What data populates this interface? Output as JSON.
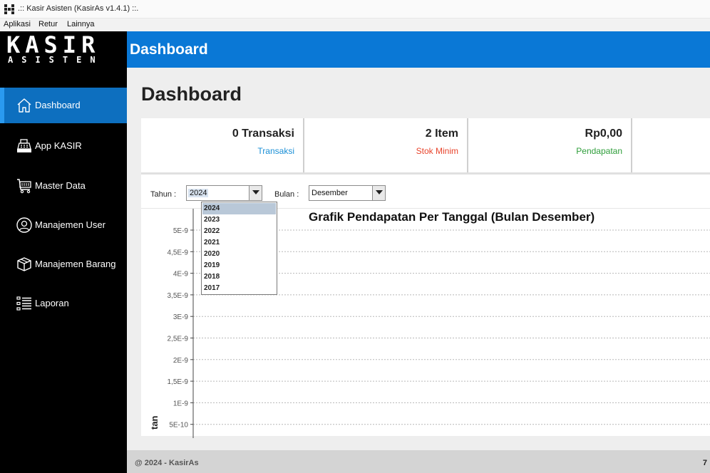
{
  "window": {
    "title": ".:: Kasir Asisten (KasirAs v1.4.1) ::."
  },
  "menu": [
    "Aplikasi",
    "Retur",
    "Lainnya"
  ],
  "logo": {
    "main": "KASIR",
    "sub": "ASISTEN"
  },
  "header": {
    "title": "Dashboard"
  },
  "sidebar": {
    "items": [
      {
        "label": "Dashboard",
        "icon": "home-icon",
        "active": true
      },
      {
        "label": "App KASIR",
        "icon": "cash-register-icon",
        "active": false
      },
      {
        "label": "Master Data",
        "icon": "cart-icon",
        "active": false
      },
      {
        "label": "Manajemen User",
        "icon": "user-icon",
        "active": false
      },
      {
        "label": "Manajemen Barang",
        "icon": "box-icon",
        "active": false
      },
      {
        "label": "Laporan",
        "icon": "list-icon",
        "active": false
      }
    ]
  },
  "main": {
    "title": "Dashboard",
    "stats": [
      {
        "value": "0 Transaksi",
        "label": "Transaksi",
        "color": "#1a8fd6"
      },
      {
        "value": "2 Item",
        "label": "Stok Minim",
        "color": "#e8442c"
      },
      {
        "value": "Rp0,00",
        "label": "Pendapatan",
        "color": "#2e9e3a"
      }
    ],
    "filters": {
      "year_label": "Tahun :",
      "year_value": "2024",
      "year_options": [
        "2024",
        "2023",
        "2022",
        "2021",
        "2020",
        "2019",
        "2018",
        "2017"
      ],
      "month_label": "Bulan :",
      "month_value": "Desember"
    }
  },
  "chart_data": {
    "type": "line",
    "title": "Grafik Pendapatan Per Tanggal (Bulan Desember)",
    "ylabel": "tan",
    "y_ticks": [
      "5E-9",
      "4,5E-9",
      "4E-9",
      "3,5E-9",
      "3E-9",
      "2,5E-9",
      "2E-9",
      "1,5E-9",
      "1E-9",
      "5E-10"
    ],
    "ylim": [
      0,
      5e-09
    ],
    "series": [],
    "grid": true
  },
  "footer": {
    "text": "@ 2024 - KasirAs",
    "right": "7"
  },
  "colors": {
    "header": "#0a78d6",
    "sidebar": "#000000",
    "active_nav": "#0d6fbf"
  }
}
